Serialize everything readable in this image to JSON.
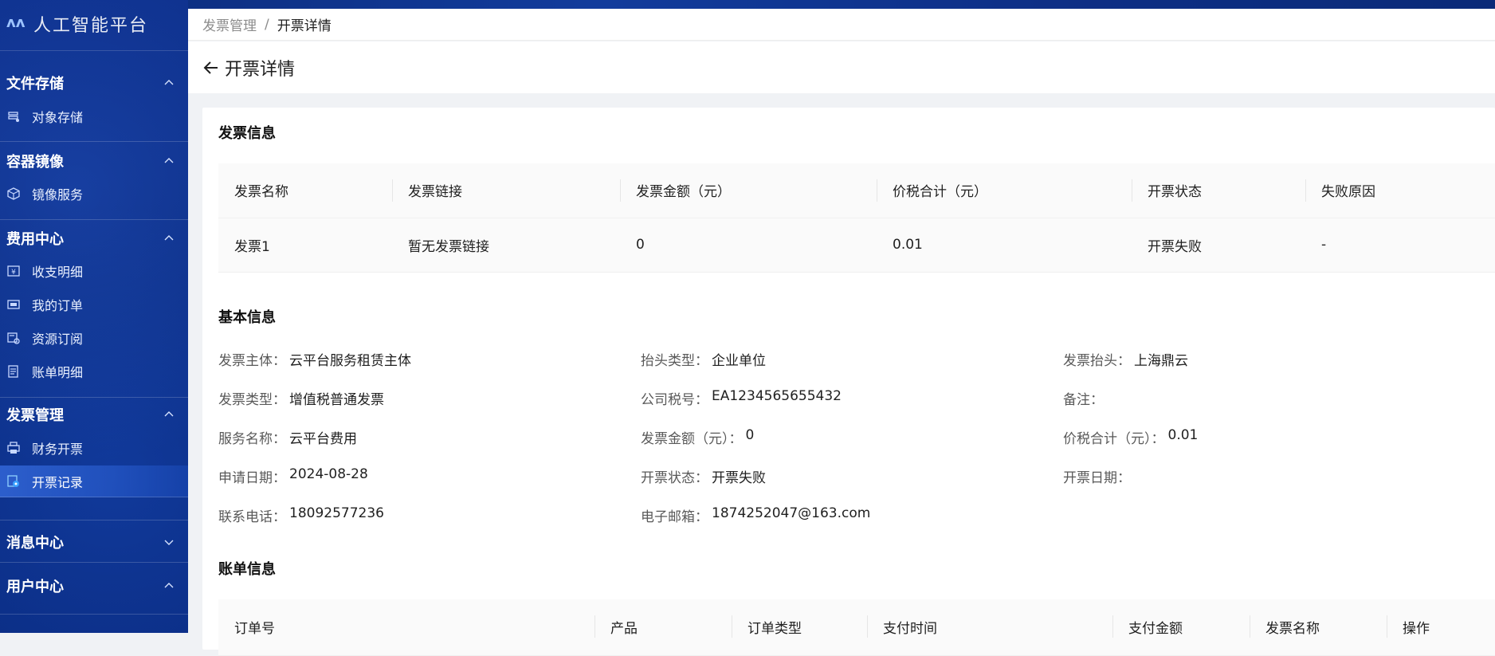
{
  "sidebar": {
    "logo_text": "人工智能平台",
    "sections": [
      {
        "title": "文件存储",
        "items": [
          {
            "label": "对象存储",
            "icon": "storage-icon"
          }
        ]
      },
      {
        "title": "容器镜像",
        "items": [
          {
            "label": "镜像服务",
            "icon": "cube-icon"
          }
        ]
      },
      {
        "title": "费用中心",
        "items": [
          {
            "label": "收支明细",
            "icon": "yen-icon"
          },
          {
            "label": "我的订单",
            "icon": "order-icon"
          },
          {
            "label": "资源订阅",
            "icon": "subscribe-icon"
          },
          {
            "label": "账单明细",
            "icon": "bill-icon"
          }
        ]
      },
      {
        "title": "发票管理",
        "items": [
          {
            "label": "财务开票",
            "icon": "printer-icon"
          },
          {
            "label": "开票记录",
            "icon": "record-icon"
          }
        ]
      },
      {
        "title": "消息中心",
        "items": []
      },
      {
        "title": "用户中心",
        "items": []
      }
    ]
  },
  "breadcrumb": {
    "parent": "发票管理",
    "separator": "/",
    "current": "开票详情"
  },
  "page_title": "开票详情",
  "invoice_info": {
    "title": "发票信息",
    "headers": [
      "发票名称",
      "发票链接",
      "发票金额（元）",
      "价税合计（元）",
      "开票状态",
      "失败原因"
    ],
    "rows": [
      [
        "发票1",
        "暂无发票链接",
        "0",
        "0.01",
        "开票失败",
        "-"
      ]
    ]
  },
  "basic_info": {
    "title": "基本信息",
    "rows": [
      [
        {
          "label": "发票主体：",
          "value": "云平台服务租赁主体"
        },
        {
          "label": "抬头类型：",
          "value": "企业单位"
        },
        {
          "label": "发票抬头：",
          "value": "上海鼎云"
        }
      ],
      [
        {
          "label": "发票类型：",
          "value": "增值税普通发票"
        },
        {
          "label": "公司税号：",
          "value": "EA1234565655432"
        },
        {
          "label": "备注：",
          "value": ""
        }
      ],
      [
        {
          "label": "服务名称：",
          "value": "云平台费用"
        },
        {
          "label": "发票金额（元）：",
          "value": "0"
        },
        {
          "label": "价税合计（元）：",
          "value": "0.01"
        }
      ],
      [
        {
          "label": "申请日期：",
          "value": "2024-08-28"
        },
        {
          "label": "开票状态：",
          "value": "开票失败"
        },
        {
          "label": "开票日期：",
          "value": ""
        }
      ],
      [
        {
          "label": "联系电话：",
          "value": "18092577236"
        },
        {
          "label": "电子邮箱：",
          "value": "1874252047@163.com"
        }
      ]
    ]
  },
  "bill_info": {
    "title": "账单信息",
    "headers": [
      "订单号",
      "产品",
      "订单类型",
      "支付时间",
      "支付金额",
      "发票名称",
      "操作"
    ]
  }
}
